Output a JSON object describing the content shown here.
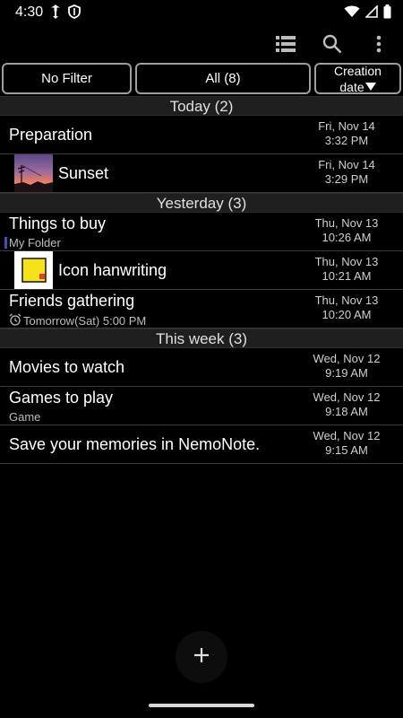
{
  "status": {
    "time": "4:30",
    "icons_left": [
      "data-saver-icon",
      "shield-icon"
    ],
    "icons_right": [
      "wifi-icon",
      "signal-icon",
      "battery-icon"
    ]
  },
  "toolbar": {
    "icons": [
      "list-view-icon",
      "search-icon",
      "more-vert-icon"
    ]
  },
  "filters": {
    "no_filter": "No Filter",
    "all": "All (8)",
    "sort_line1": "Creation",
    "sort_line2": "date"
  },
  "sections": [
    {
      "header": "Today (2)",
      "items": [
        {
          "title": "Preparation",
          "date": "Fri, Nov 14",
          "time": "3:32 PM"
        },
        {
          "title": "Sunset",
          "date": "Fri, Nov 14",
          "time": "3:29 PM"
        }
      ]
    },
    {
      "header": "Yesterday (3)",
      "items": [
        {
          "title": "Things to buy",
          "subtitle": "My Folder",
          "date": "Thu, Nov 13",
          "time": "10:26 AM"
        },
        {
          "title": "Icon hanwriting",
          "date": "Thu, Nov 13",
          "time": "10:21 AM"
        },
        {
          "title": "Friends gathering",
          "subtitle": "Tomorrow(Sat) 5:00 PM",
          "date": "Thu, Nov 13",
          "time": "10:20 AM"
        }
      ]
    },
    {
      "header": "This week (3)",
      "items": [
        {
          "title": "Movies to watch",
          "date": "Wed, Nov 12",
          "time": "9:19 AM"
        },
        {
          "title": "Games to play",
          "subtitle": "Game",
          "date": "Wed, Nov 12",
          "time": "9:18 AM"
        },
        {
          "title": "Save your memories in NemoNote.",
          "date": "Wed, Nov 12",
          "time": "9:15 AM"
        }
      ]
    }
  ],
  "colors": {
    "background": "#000000",
    "section_bg": "#1f1f1f",
    "folder_accent": "#3f51b5",
    "button_border": "#9e9e9e"
  }
}
